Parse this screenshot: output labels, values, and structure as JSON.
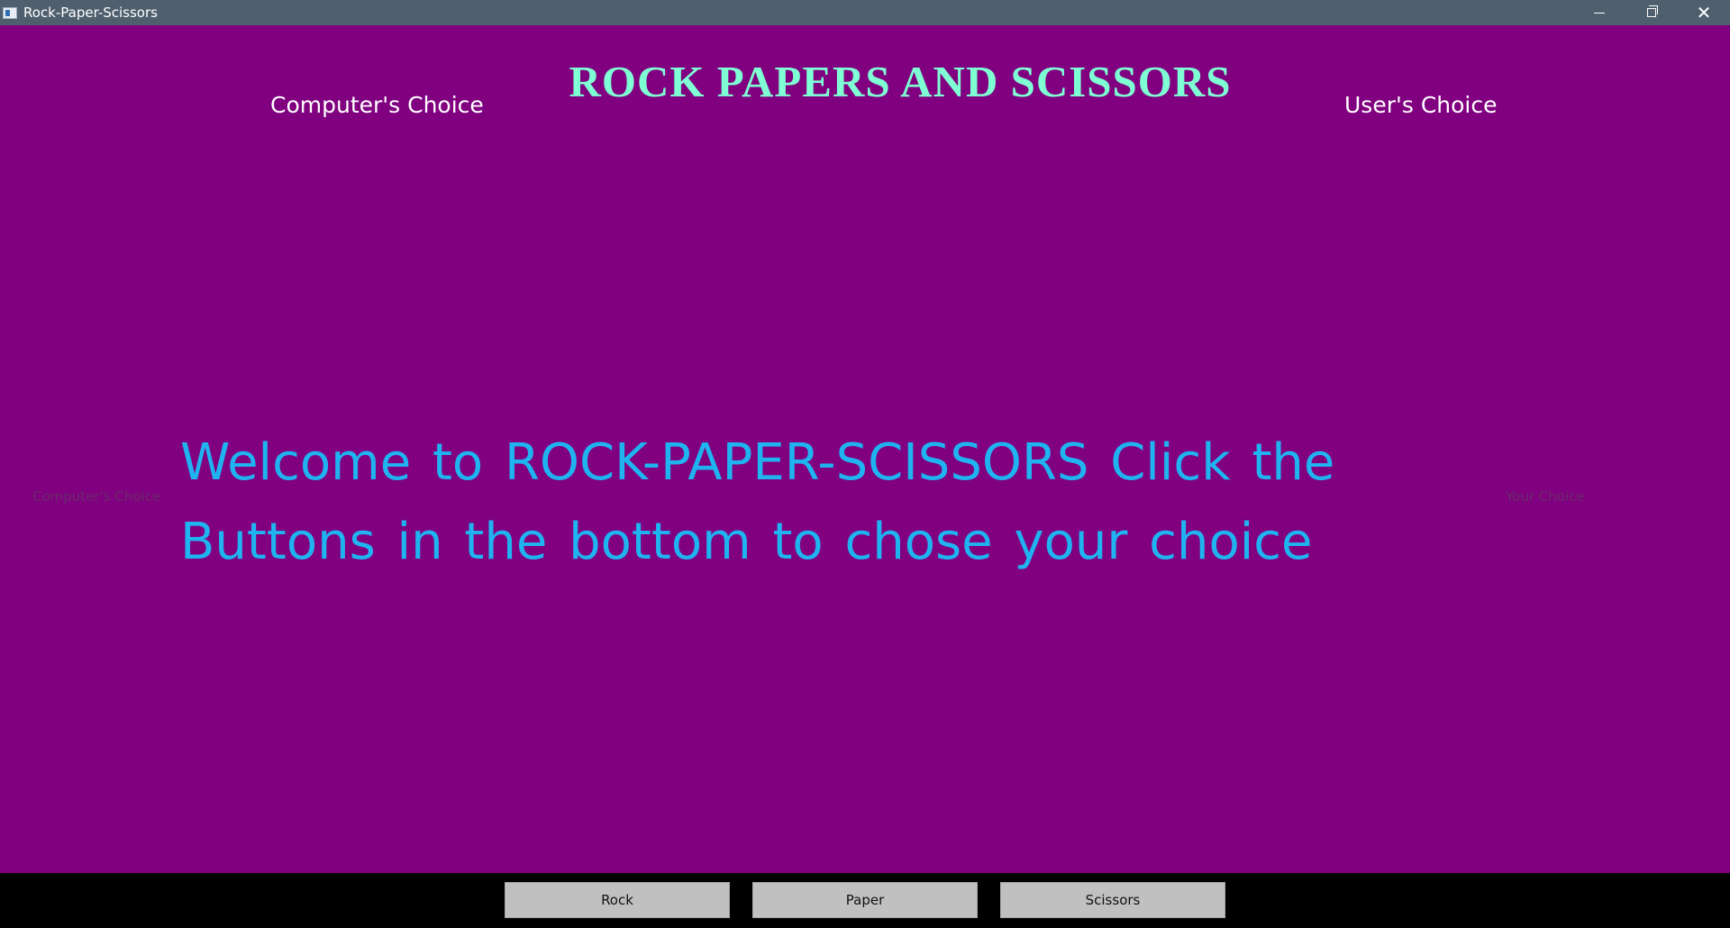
{
  "window": {
    "title": "Rock-Paper-Scissors",
    "icon": "app-window-icon",
    "controls": {
      "minimize_icon": "minimize-icon",
      "maximize_icon": "restore-icon",
      "close_glyph": "✕"
    }
  },
  "game": {
    "title": "ROCK PAPERS AND SCISSORS",
    "computer_choice_header": "Computer's Choice",
    "user_choice_header": "User's Choice",
    "computer_choice_display": "Computer's Choice",
    "user_choice_display": "Your Choice",
    "welcome_message": "Welcome to ROCK-PAPER-SCISSORS Click the Buttons in the bottom to chose your choice"
  },
  "buttons": {
    "rock": "Rock",
    "paper": "Paper",
    "scissors": "Scissors"
  },
  "colors": {
    "background": "#800080",
    "titlebar": "#4f5f6e",
    "title_text": "#7fffd4",
    "welcome_text": "#1fb4f0",
    "bottom_bar": "#000000",
    "button": "#c0c0c0"
  }
}
